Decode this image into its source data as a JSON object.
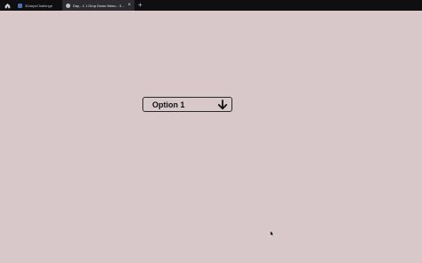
{
  "browser": {
    "tabs": [
      {
        "title": "30daysChallenge",
        "active": false,
        "favicon": "page-icon"
      },
      {
        "title": "Day - 1 1 Drop Down Menu - 30day",
        "active": true,
        "favicon": "globe-icon"
      }
    ],
    "icons": {
      "home": "home-icon",
      "close": "×",
      "new_tab": "+"
    }
  },
  "main": {
    "dropdown": {
      "selected": "Option 1",
      "icon": "arrow-down-icon"
    }
  },
  "colors": {
    "background": "#d8c8c9",
    "tabbar": "#0f0f12",
    "active_tab": "#2b2b30",
    "border": "#2a2a2a"
  }
}
